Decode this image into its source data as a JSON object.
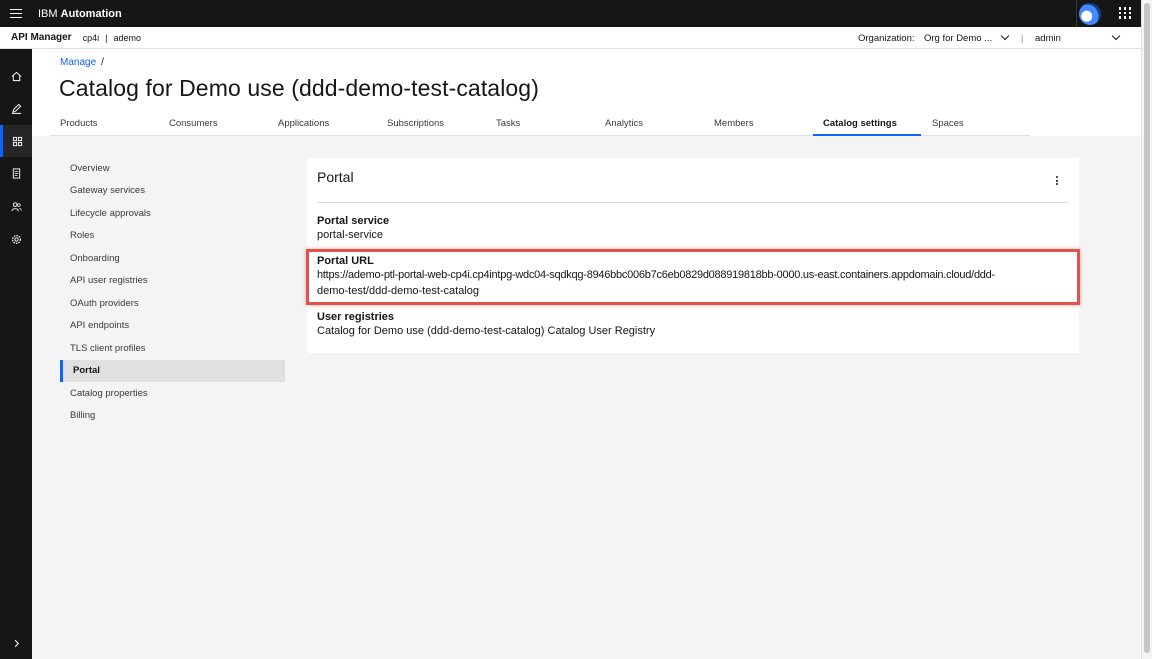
{
  "header": {
    "brand_prefix": "IBM ",
    "brand_name": "Automation"
  },
  "subheader": {
    "app_name": "API Manager",
    "provider_org": "cp4i",
    "separator": "|",
    "catalog_org": "ademo",
    "org_label": "Organization:",
    "org_value": "Org for Demo ...",
    "divider": "|",
    "user": "admin"
  },
  "breadcrumb": {
    "link": "Manage",
    "separator": "/"
  },
  "page": {
    "title": "Catalog for Demo use (ddd-demo-test-catalog)"
  },
  "tabs": [
    {
      "label": "Products"
    },
    {
      "label": "Consumers"
    },
    {
      "label": "Applications"
    },
    {
      "label": "Subscriptions"
    },
    {
      "label": "Tasks"
    },
    {
      "label": "Analytics"
    },
    {
      "label": "Members"
    },
    {
      "label": "Catalog settings",
      "active": true
    },
    {
      "label": "Spaces"
    }
  ],
  "sidenav": [
    {
      "label": "Overview"
    },
    {
      "label": "Gateway services"
    },
    {
      "label": "Lifecycle approvals"
    },
    {
      "label": "Roles"
    },
    {
      "label": "Onboarding"
    },
    {
      "label": "API user registries"
    },
    {
      "label": "OAuth providers"
    },
    {
      "label": "API endpoints"
    },
    {
      "label": "TLS client profiles"
    },
    {
      "label": "Portal",
      "active": true
    },
    {
      "label": "Catalog properties"
    },
    {
      "label": "Billing"
    }
  ],
  "portal": {
    "title": "Portal",
    "service_label": "Portal service",
    "service_value": "portal-service",
    "url_label": "Portal URL",
    "url_line1": "https://ademo-ptl-portal-web-cp4i.cp4intpg-wdc04-sqdkqg-8946bbc006b7c6eb0829d088919818bb-0000.us-east.containers.appdomain.cloud/ddd-",
    "url_line2": "demo-test/ddd-demo-test-catalog",
    "registries_label": "User registries",
    "registries_value": "Catalog for Demo use (ddd-demo-test-catalog) Catalog User Registry"
  },
  "colors": {
    "accent": "#0f62fe",
    "highlight": "#e0524a",
    "header_bg": "#161616"
  },
  "rail_icons": [
    "home-icon",
    "edit-icon",
    "catalog-grid-icon",
    "document-icon",
    "users-icon",
    "settings-icon",
    "expand-icon"
  ]
}
